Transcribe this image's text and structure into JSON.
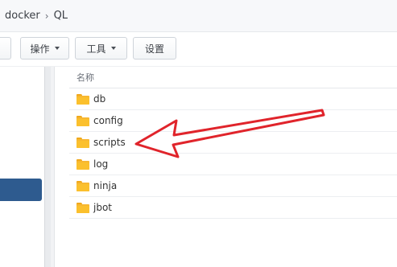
{
  "breadcrumb": {
    "items": [
      "docker",
      "QL"
    ],
    "separator": "›"
  },
  "toolbar": {
    "action_label": "操作",
    "tools_label": "工具",
    "settings_label": "设置"
  },
  "file_list": {
    "header_name": "名称",
    "rows": [
      {
        "name": "db"
      },
      {
        "name": "config"
      },
      {
        "name": "scripts"
      },
      {
        "name": "log"
      },
      {
        "name": "ninja"
      },
      {
        "name": "jbot"
      }
    ]
  },
  "colors": {
    "annotation_arrow": "#e0242b",
    "sidebar_selected": "#2e5b8f",
    "folder": "#fbc02d"
  },
  "icons": {
    "folder": "folder-icon",
    "dropdown": "caret-down-icon",
    "separator": "chevron-right-icon"
  }
}
